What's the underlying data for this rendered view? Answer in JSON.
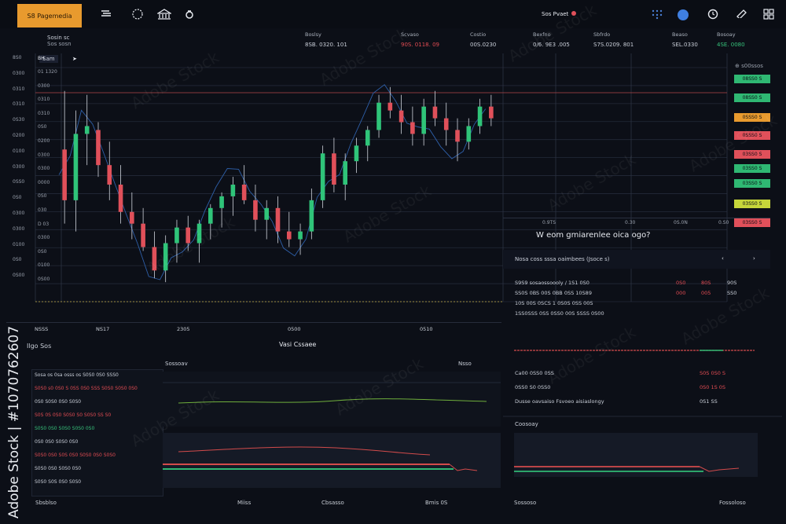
{
  "colors": {
    "up": "#2fc479",
    "down": "#e0505a",
    "brand": "#e89a2e",
    "bg": "#0c0f17"
  },
  "topbar": {
    "brand_label": "S8 Pagemedia",
    "account_label": "Sos Pvaet",
    "icons": [
      "menu-icon",
      "globe-icon",
      "bank-icon",
      "bell-icon",
      "apps-icon",
      "profile-icon",
      "clock-icon",
      "edit-icon",
      "grid-icon"
    ]
  },
  "symbol": {
    "name": "Sosin sc",
    "sub": "Sos sosn"
  },
  "tickers": [
    {
      "label": "Boslsy",
      "value": "8SB. 0320. 101",
      "tone": "normal"
    },
    {
      "label": "Scvaso",
      "value": "90S. 0118. 09",
      "tone": "red"
    },
    {
      "label": "Costio",
      "value": "00S.0230",
      "tone": "normal"
    },
    {
      "label": "Bexfno",
      "value": "0/6. 9E3 .005",
      "tone": "normal"
    },
    {
      "label": "Sbfrdo",
      "value": "S7S.0209. 801",
      "tone": "normal"
    },
    {
      "label": "Beaso",
      "value": "SEL.0330",
      "tone": "normal"
    },
    {
      "label": "Bosoay",
      "value": "4SE. 0080",
      "tone": "green"
    }
  ],
  "chart": {
    "timeframe": "Sam",
    "header_value": "BH",
    "axis_prices": [
      "01 1320",
      "0300",
      "0310",
      "0310",
      "0S0",
      "0200",
      "0300",
      "0300",
      "0000",
      "0S0",
      "030",
      "D 03",
      "0300",
      "0S0",
      "0100",
      "0S00"
    ],
    "axis_marks": [
      "8S0",
      "0300",
      "0310",
      "0310",
      "0S30",
      "0200",
      "0100",
      "0300",
      "0SS0",
      "0S0",
      "0300",
      "0300",
      "0100",
      "0S0",
      "0S00"
    ],
    "time_labels": [
      "NSSS",
      "NS17",
      "2305",
      "0500",
      "0510"
    ],
    "right_marks": [
      "0.9TS",
      "0.30",
      "0S.0N",
      "0.S0"
    ]
  },
  "chart_data": {
    "type": "candlestick",
    "candles": [
      {
        "o": 1190,
        "h": 1340,
        "l": 1000,
        "c": 1060
      },
      {
        "o": 1060,
        "h": 1290,
        "l": 980,
        "c": 1230
      },
      {
        "o": 1230,
        "h": 1330,
        "l": 1150,
        "c": 1250
      },
      {
        "o": 1240,
        "h": 1260,
        "l": 1120,
        "c": 1150
      },
      {
        "o": 1150,
        "h": 1210,
        "l": 1060,
        "c": 1100
      },
      {
        "o": 1100,
        "h": 1150,
        "l": 1000,
        "c": 1030
      },
      {
        "o": 1030,
        "h": 1080,
        "l": 960,
        "c": 1000
      },
      {
        "o": 1000,
        "h": 1040,
        "l": 930,
        "c": 940
      },
      {
        "o": 940,
        "h": 980,
        "l": 860,
        "c": 880
      },
      {
        "o": 880,
        "h": 970,
        "l": 850,
        "c": 950
      },
      {
        "o": 950,
        "h": 1010,
        "l": 900,
        "c": 990
      },
      {
        "o": 990,
        "h": 1020,
        "l": 930,
        "c": 950
      },
      {
        "o": 950,
        "h": 1010,
        "l": 900,
        "c": 1000
      },
      {
        "o": 1000,
        "h": 1050,
        "l": 960,
        "c": 1040
      },
      {
        "o": 1040,
        "h": 1080,
        "l": 990,
        "c": 1070
      },
      {
        "o": 1070,
        "h": 1120,
        "l": 1020,
        "c": 1100
      },
      {
        "o": 1100,
        "h": 1150,
        "l": 1050,
        "c": 1060
      },
      {
        "o": 1060,
        "h": 1100,
        "l": 980,
        "c": 1010
      },
      {
        "o": 1010,
        "h": 1060,
        "l": 960,
        "c": 1040
      },
      {
        "o": 1040,
        "h": 1070,
        "l": 950,
        "c": 980
      },
      {
        "o": 980,
        "h": 1030,
        "l": 940,
        "c": 960
      },
      {
        "o": 960,
        "h": 1000,
        "l": 920,
        "c": 980
      },
      {
        "o": 980,
        "h": 1090,
        "l": 960,
        "c": 1060
      },
      {
        "o": 1060,
        "h": 1200,
        "l": 1040,
        "c": 1180
      },
      {
        "o": 1180,
        "h": 1220,
        "l": 1080,
        "c": 1100
      },
      {
        "o": 1100,
        "h": 1180,
        "l": 1060,
        "c": 1160
      },
      {
        "o": 1160,
        "h": 1220,
        "l": 1130,
        "c": 1200
      },
      {
        "o": 1200,
        "h": 1250,
        "l": 1160,
        "c": 1240
      },
      {
        "o": 1240,
        "h": 1330,
        "l": 1220,
        "c": 1310
      },
      {
        "o": 1310,
        "h": 1350,
        "l": 1270,
        "c": 1290
      },
      {
        "o": 1290,
        "h": 1330,
        "l": 1230,
        "c": 1260
      },
      {
        "o": 1260,
        "h": 1300,
        "l": 1200,
        "c": 1230
      },
      {
        "o": 1230,
        "h": 1320,
        "l": 1200,
        "c": 1300
      },
      {
        "o": 1300,
        "h": 1340,
        "l": 1250,
        "c": 1270
      },
      {
        "o": 1270,
        "h": 1310,
        "l": 1200,
        "c": 1240
      },
      {
        "o": 1240,
        "h": 1270,
        "l": 1160,
        "c": 1210
      },
      {
        "o": 1210,
        "h": 1270,
        "l": 1190,
        "c": 1250
      },
      {
        "o": 1250,
        "h": 1320,
        "l": 1230,
        "c": 1300
      },
      {
        "o": 1300,
        "h": 1330,
        "l": 1250,
        "c": 1270
      }
    ],
    "grid": true
  },
  "order_buttons": [
    {
      "label": "08SS0 S",
      "color": "#2fb873"
    },
    {
      "label": "08SS0 S",
      "color": "#2fb873"
    },
    {
      "label": "0SSS0 S",
      "color": "#e89a2e"
    },
    {
      "label": "0SSS0 S",
      "color": "#e0505a"
    },
    {
      "label": "03SS0 S",
      "color": "#e0505a"
    },
    {
      "label": "03SS0 S",
      "color": "#2fb873"
    },
    {
      "label": "03SS0 S",
      "color": "#2fb873"
    },
    {
      "label": "03SS0 S",
      "color": "#c6d63a"
    },
    {
      "label": "03SS0 S",
      "color": "#e0505a"
    }
  ],
  "side_panel": {
    "question": "W eom gmiarenlee oica ogo?",
    "subtitle": "Nosa coss sssa oaimbees (Jsoce s)",
    "rows": [
      [
        "S9S9 sosaossoooly / 1S1 0S0",
        "0S0",
        "80S",
        "90S"
      ],
      [
        "SS0S 0BS 00S 0BB 0SS 10S89",
        "000",
        "005",
        "SS0"
      ],
      [
        "10S 00S 0SCS 1 0S0S 0SS 00S",
        "",
        "",
        ""
      ],
      [
        "1SS0SSS 0SS 0SS0 00S SSSS 0S00",
        "",
        "",
        ""
      ]
    ],
    "metrics": [
      {
        "label": "Ca00 0SS0 0SS",
        "value": "S0S 0S0 S",
        "tone": "red"
      },
      {
        "label": "0SS0 S0 0SS0",
        "value": "0S0 1S 0S",
        "tone": "red"
      },
      {
        "label": "Dusse oavsaiso  Fsvoeo aisiaslongy",
        "value": "0S1 SS",
        "tone": "normal"
      }
    ],
    "sub_chart_label": "Coosoay"
  },
  "bottom": {
    "left_title": "Ilgo Sos",
    "center_title": "Vasi Cssaee",
    "panel_label": "Sossoav",
    "mid_label": "Nsso",
    "list": [
      {
        "text": "Sosa os 0sa osss os S0S0 0S0 SSS0",
        "tone": "normal"
      },
      {
        "text": "S0S0 s0 0S0 S 0SS 0S0 SSS S0S0 S0S0 0S0",
        "tone": "red"
      },
      {
        "text": "0S0 S0S0 0S0 S0S0",
        "tone": "normal"
      },
      {
        "text": "S0S 0S 0S0 S0S0 S0 S0S0 SS S0",
        "tone": "red"
      },
      {
        "text": "S0S0 0S0 S0S0 S0S0 0S0",
        "tone": "green"
      },
      {
        "text": "0S0 0S0 S0S0 0S0",
        "tone": "normal"
      },
      {
        "text": "S0S0 0S0 S0S 0S0 S0S0 0S0 S0S0",
        "tone": "red"
      },
      {
        "text": "S0S0 0S0 S0S0 0S0",
        "tone": "normal"
      },
      {
        "text": "S0S0 S0S 0S0 S0S0",
        "tone": "normal"
      }
    ],
    "footer": [
      "Sbsblso",
      "Miiss",
      "Cbsasso",
      "Bmis 0S",
      "Sossoso",
      "Fossoloso"
    ]
  },
  "watermark": {
    "text": "Adobe Stock",
    "id": "#1070762607"
  }
}
